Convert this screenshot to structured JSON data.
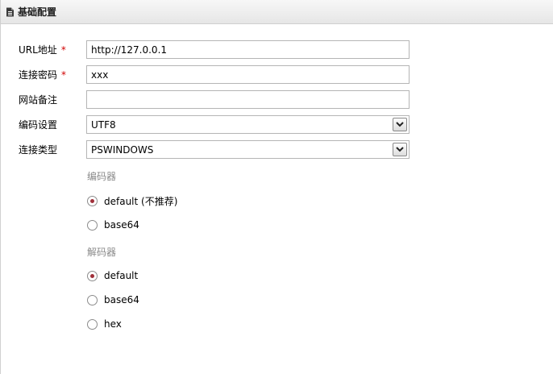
{
  "header": {
    "title": "基础配置",
    "icon": "document-icon"
  },
  "form": {
    "url": {
      "label": "URL地址",
      "required_mark": "*",
      "value": "http://127.0.0.1"
    },
    "password": {
      "label": "连接密码",
      "required_mark": "*",
      "value": "xxx"
    },
    "note": {
      "label": "网站备注",
      "value": ""
    },
    "encoding": {
      "label": "编码设置",
      "selected": "UTF8"
    },
    "conn_type": {
      "label": "连接类型",
      "selected": "PSWINDOWS"
    }
  },
  "encoder": {
    "title": "编码器",
    "options": [
      {
        "label": "default (不推荐)",
        "checked": true
      },
      {
        "label": "base64",
        "checked": false
      }
    ]
  },
  "decoder": {
    "title": "解码器",
    "options": [
      {
        "label": "default",
        "checked": true
      },
      {
        "label": "base64",
        "checked": false
      },
      {
        "label": "hex",
        "checked": false
      }
    ]
  },
  "colors": {
    "required": "#d00000",
    "group_title": "#8a8a8a",
    "radio_dot": "#a0303a"
  }
}
